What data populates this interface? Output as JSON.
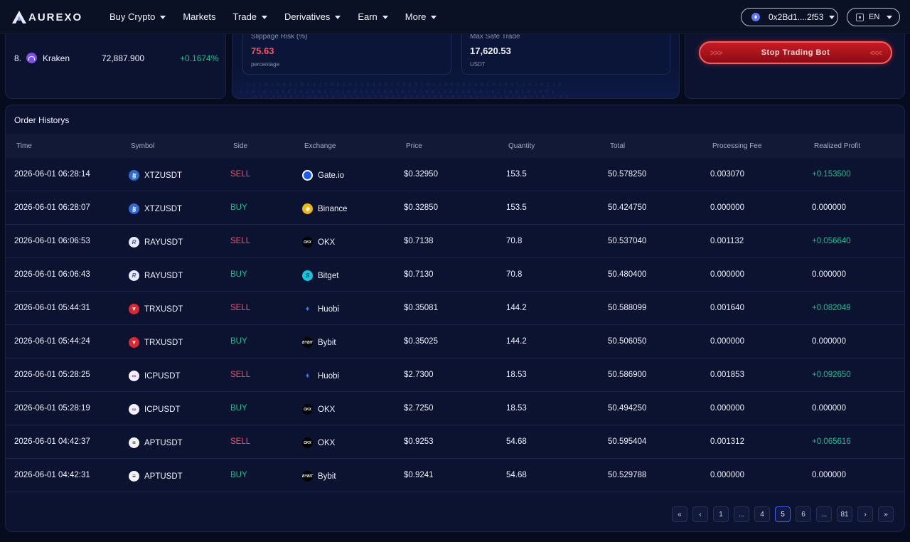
{
  "nav": {
    "logo_text": "AUREXO",
    "links": [
      {
        "label": "Buy Crypto",
        "dropdown": true
      },
      {
        "label": "Markets",
        "dropdown": false
      },
      {
        "label": "Trade",
        "dropdown": true
      },
      {
        "label": "Derivatives",
        "dropdown": true
      },
      {
        "label": "Earn",
        "dropdown": true
      },
      {
        "label": "More",
        "dropdown": true
      }
    ],
    "wallet": "0x2Bd1....2f53",
    "language": "EN"
  },
  "ranking": {
    "row": {
      "rank": "8.",
      "name": "Kraken",
      "price": "72,887.900",
      "change": "+0.1674%"
    }
  },
  "risk": {
    "slippage": {
      "label": "Slippage Risk (%)",
      "value": "75.63",
      "unit": "percentage"
    },
    "max_trade": {
      "label": "Max Safe Trade",
      "value": "17,620.53",
      "unit": "USDT"
    }
  },
  "bot": {
    "stop_label": "Stop Trading Bot"
  },
  "orders": {
    "title": "Order Historys",
    "columns": [
      "Time",
      "Symbol",
      "Side",
      "Exchange",
      "Price",
      "Quantity",
      "Total",
      "Processing Fee",
      "Realized Profit"
    ],
    "rows": [
      {
        "time": "2026-06-01 06:28:14",
        "symbol": "XTZUSDT",
        "side": "SELL",
        "exchange": "Gate.io",
        "price": "$0.32950",
        "qty": "153.5",
        "total": "50.578250",
        "fee": "0.003070",
        "profit": "+0.153500"
      },
      {
        "time": "2026-06-01 06:28:07",
        "symbol": "XTZUSDT",
        "side": "BUY",
        "exchange": "Binance",
        "price": "$0.32850",
        "qty": "153.5",
        "total": "50.424750",
        "fee": "0.000000",
        "profit": "0.000000"
      },
      {
        "time": "2026-06-01 06:06:53",
        "symbol": "RAYUSDT",
        "side": "SELL",
        "exchange": "OKX",
        "price": "$0.7138",
        "qty": "70.8",
        "total": "50.537040",
        "fee": "0.001132",
        "profit": "+0.056640"
      },
      {
        "time": "2026-06-01 06:06:43",
        "symbol": "RAYUSDT",
        "side": "BUY",
        "exchange": "Bitget",
        "price": "$0.7130",
        "qty": "70.8",
        "total": "50.480400",
        "fee": "0.000000",
        "profit": "0.000000"
      },
      {
        "time": "2026-06-01 05:44:31",
        "symbol": "TRXUSDT",
        "side": "SELL",
        "exchange": "Huobi",
        "price": "$0.35081",
        "qty": "144.2",
        "total": "50.588099",
        "fee": "0.001640",
        "profit": "+0.082049"
      },
      {
        "time": "2026-06-01 05:44:24",
        "symbol": "TRXUSDT",
        "side": "BUY",
        "exchange": "Bybit",
        "price": "$0.35025",
        "qty": "144.2",
        "total": "50.506050",
        "fee": "0.000000",
        "profit": "0.000000"
      },
      {
        "time": "2026-06-01 05:28:25",
        "symbol": "ICPUSDT",
        "side": "SELL",
        "exchange": "Huobi",
        "price": "$2.7300",
        "qty": "18.53",
        "total": "50.586900",
        "fee": "0.001853",
        "profit": "+0.092650"
      },
      {
        "time": "2026-06-01 05:28:19",
        "symbol": "ICPUSDT",
        "side": "BUY",
        "exchange": "OKX",
        "price": "$2.7250",
        "qty": "18.53",
        "total": "50.494250",
        "fee": "0.000000",
        "profit": "0.000000"
      },
      {
        "time": "2026-06-01 04:42:37",
        "symbol": "APTUSDT",
        "side": "SELL",
        "exchange": "OKX",
        "price": "$0.9253",
        "qty": "54.68",
        "total": "50.595404",
        "fee": "0.001312",
        "profit": "+0.065616"
      },
      {
        "time": "2026-06-01 04:42:31",
        "symbol": "APTUSDT",
        "side": "BUY",
        "exchange": "Bybit",
        "price": "$0.9241",
        "qty": "54.68",
        "total": "50.529788",
        "fee": "0.000000",
        "profit": "0.000000"
      }
    ]
  },
  "pagination": {
    "items": [
      "«",
      "‹",
      "1",
      "...",
      "4",
      "5",
      "6",
      "...",
      "81",
      "›",
      "»"
    ],
    "current": "5"
  },
  "colors": {
    "sell": "#ff4f64",
    "buy": "#19c08a",
    "accent": "#3b62e8",
    "danger_button": "#c61c24"
  }
}
